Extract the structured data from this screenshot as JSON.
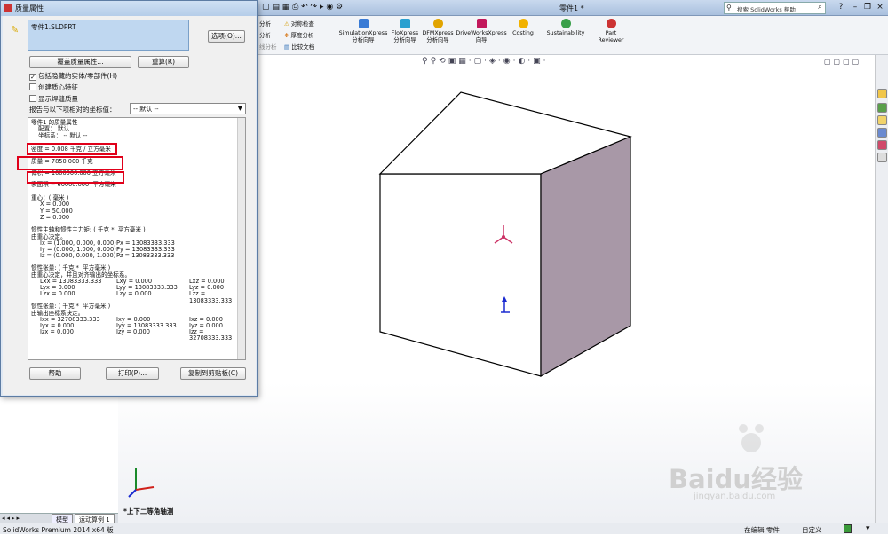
{
  "titlebar": {
    "doc_title": "零件1 *",
    "help_search_placeholder": "搜索 SolidWorks 帮助"
  },
  "toolbar": {
    "left_items": [
      "分析",
      "分析",
      "线分析"
    ],
    "mid_items": [
      {
        "label": "对称检查",
        "icon": "symmetry-icon"
      },
      {
        "label": "厚度分析",
        "icon": "thickness-icon"
      },
      {
        "label": "比较文档",
        "icon": "compare-icon"
      }
    ],
    "tools": [
      {
        "label1": "SimulationXpress",
        "label2": "分析向导",
        "color": "#3a7bd5"
      },
      {
        "label1": "FloXpress",
        "label2": "分析向导",
        "color": "#2aa0d0"
      },
      {
        "label1": "DFMXpress",
        "label2": "分析向导",
        "color": "#e1a400"
      },
      {
        "label1": "DriveWorksXpress",
        "label2": "向导",
        "color": "#c2185b"
      },
      {
        "label1": "Costing",
        "label2": "",
        "color": "#f2b200"
      },
      {
        "label1": "Sustainability",
        "label2": "",
        "color": "#3aa04a"
      },
      {
        "label1": "Part",
        "label2": "Reviewer",
        "color": "#cc3333"
      }
    ]
  },
  "dialog": {
    "title": "质量属性",
    "file": "零件1.SLDPRT",
    "options_button": "选项(O)...",
    "override_button": "覆盖质量属性...",
    "recalc_button": "重算(R)",
    "checkboxes": [
      {
        "label": "包括隐藏的实体/零部件(H)",
        "checked": true
      },
      {
        "label": "创建质心特征",
        "checked": false
      },
      {
        "label": "显示焊缝质量",
        "checked": false
      }
    ],
    "coord_label": "报告与以下项相对的坐标值：",
    "coord_value": "-- 默认 --",
    "results": {
      "header": "零件1 的质量属性",
      "config": "配置： 默认",
      "coordsys": "坐标系： -- 默认 --",
      "density": "密度 = 0.008 千克 / 立方毫米",
      "mass": "质量 = 7850.000 千克",
      "volume": "体积 = 1000000.000 立方毫米",
      "area": "表面积 = 60000.000  平方毫米",
      "cg_title": "重心：( 毫米 )",
      "cg_x": "X = 0.000",
      "cg_y": "Y = 50.000",
      "cg_z": "Z = 0.000",
      "principal_title": "惯性主轴和惯性主力矩: ( 千克 *  平方毫米 )",
      "principal_sub": "由重心决定。",
      "ix": "Ix = (1.000, 0.000, 0.000)",
      "iy": "Iy = (0.000, 1.000, 0.000)",
      "iz": "Iz = (0.000, 0.000, 1.000)",
      "px": "Px = 13083333.333",
      "py": "Py = 13083333.333",
      "pz": "Pz = 13083333.333",
      "tensor1_title": "惯性张量: ( 千克 *  平方毫米 )",
      "tensor1_sub": "由重心决定，并且对齐输出的坐标系。",
      "t1": [
        [
          "Lxx = 13083333.333",
          "Lxy = 0.000",
          "Lxz = 0.000"
        ],
        [
          "Lyx = 0.000",
          "Lyy = 13083333.333",
          "Lyz = 0.000"
        ],
        [
          "Lzx = 0.000",
          "Lzy = 0.000",
          "Lzz = 13083333.333"
        ]
      ],
      "tensor2_title": "惯性张量: ( 千克 *  平方毫米 )",
      "tensor2_sub": "由输出座标系决定。",
      "t2": [
        [
          "Ixx = 32708333.333",
          "Ixy = 0.000",
          "Ixz = 0.000"
        ],
        [
          "Iyx = 0.000",
          "Iyy = 13083333.333",
          "Iyz = 0.000"
        ],
        [
          "Izx = 0.000",
          "Izy = 0.000",
          "Izz = 32708333.333"
        ]
      ]
    },
    "help_button": "帮助",
    "print_button": "打印(P)...",
    "copy_button": "复制到剪贴板(C)"
  },
  "view": {
    "label": "*上下二等角轴测"
  },
  "tabs": {
    "model": "模型",
    "motion": "运动算例 1"
  },
  "status": {
    "left": "SolidWorks Premium 2014 x64 版",
    "editing": "在编辑 零件",
    "units": "自定义"
  },
  "watermark": {
    "text": "Baidu经验",
    "url": "jingyan.baidu.com"
  },
  "colors": {
    "highlight": "#e0001a",
    "cube_side": "#a898a7",
    "cube_front": "#ffffff"
  }
}
